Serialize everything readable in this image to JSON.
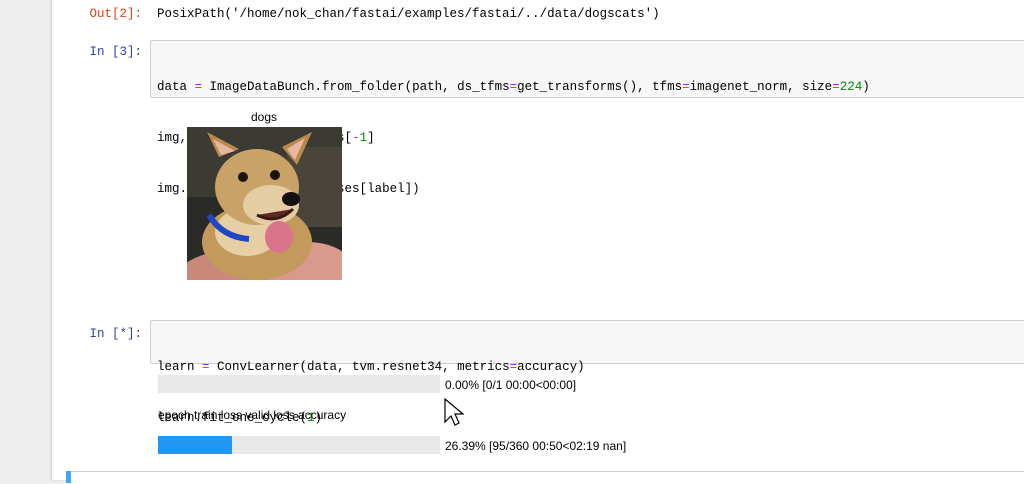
{
  "cells": [
    {
      "out_prompt": "Out[2]:",
      "output": "PosixPath('/home/nok_chan/fastai/examples/fastai/../data/dogscats')"
    },
    {
      "in_prompt": "In [3]:",
      "code_lines": [
        "data = ImageDataBunch.from_folder(path, ds_tfms=get_transforms(), tfms=imagenet_norm, size=224)",
        "img,label = data.valid_ds[-1]",
        "img.show(title=data.classes[label])"
      ],
      "figure_title": "dogs",
      "figure_image": "dog-photo"
    },
    {
      "in_prompt": "In [*]:",
      "code_lines": [
        "learn = ConvLearner(data, tvm.resnet34, metrics=accuracy)",
        "learn.fit_one_cycle(1)"
      ],
      "progress_overall": {
        "fraction": 0.0,
        "label": "0.00% [0/1 00:00<00:00]"
      },
      "table_header": "epoch train loss valid loss accuracy",
      "progress_epoch": {
        "fraction": 0.2639,
        "label": "26.39% [95/360 00:50<02:19 nan]",
        "color": "#2196f3"
      }
    }
  ],
  "colors": {
    "out_prompt": "#d84315",
    "in_prompt": "#303f9f",
    "operator": "#aa22ff",
    "number": "#008800"
  },
  "icons": {
    "cursor": "mouse-pointer-icon"
  }
}
